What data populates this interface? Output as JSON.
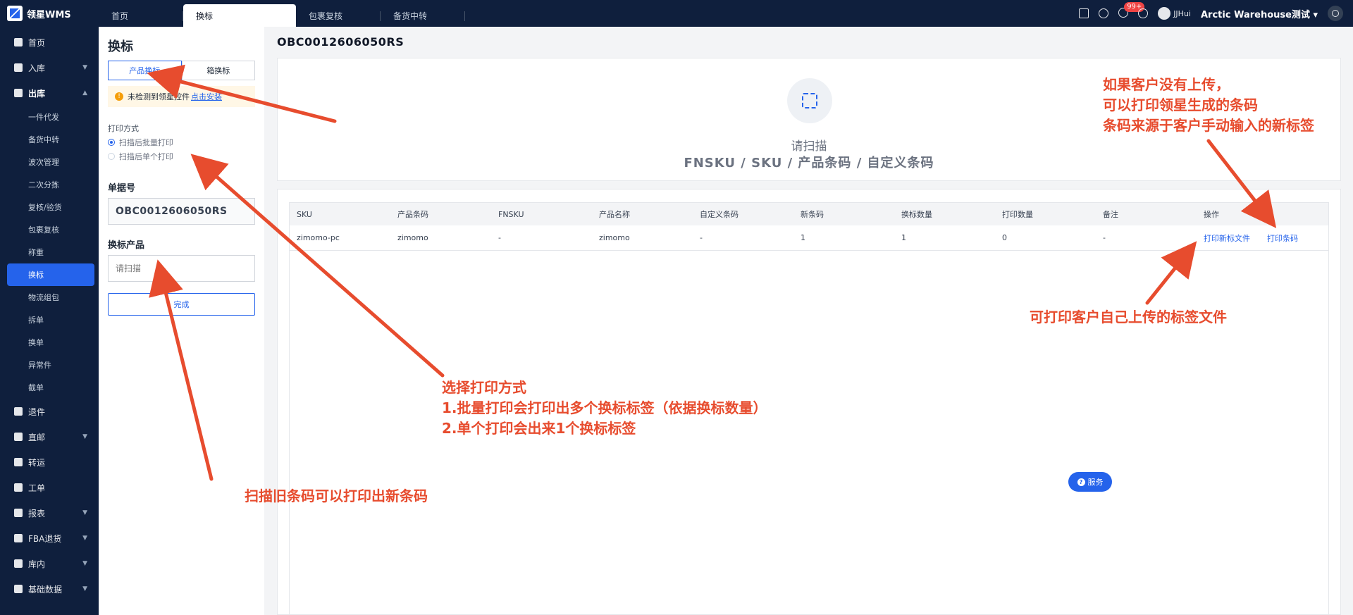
{
  "app": {
    "name": "领星WMS"
  },
  "tabs": [
    {
      "label": "首页"
    },
    {
      "label": "换标"
    },
    {
      "label": "包裹复核"
    },
    {
      "label": "备货中转"
    }
  ],
  "header": {
    "notification_count": "99+",
    "user": "JJHui",
    "warehouse": "Arctic Warehouse测试"
  },
  "sidebar": {
    "items": [
      {
        "label": "首页"
      },
      {
        "label": "入库"
      },
      {
        "label": "出库"
      },
      {
        "label": "退件"
      },
      {
        "label": "直邮"
      },
      {
        "label": "转运"
      },
      {
        "label": "工单"
      },
      {
        "label": "报表"
      },
      {
        "label": "FBA退货"
      },
      {
        "label": "库内"
      },
      {
        "label": "基础数据"
      }
    ],
    "outbound_sub": [
      {
        "label": "一件代发"
      },
      {
        "label": "备货中转"
      },
      {
        "label": "波次管理"
      },
      {
        "label": "二次分拣"
      },
      {
        "label": "复核/验货"
      },
      {
        "label": "包裹复核"
      },
      {
        "label": "称重"
      },
      {
        "label": "换标"
      },
      {
        "label": "物流组包"
      },
      {
        "label": "拆单"
      },
      {
        "label": "换单"
      },
      {
        "label": "异常件"
      },
      {
        "label": "截单"
      }
    ]
  },
  "left_panel": {
    "title": "换标",
    "segments": [
      "产品换标",
      "箱换标"
    ],
    "warning": "未检测到领星控件",
    "warning_link": "点击安装",
    "print_mode_label": "打印方式",
    "print_modes": [
      "扫描后批量打印",
      "扫描后单个打印"
    ],
    "doc_no_label": "单据号",
    "doc_no": "OBC0012606050RS",
    "product_label": "换标产品",
    "product_placeholder": "请扫描",
    "done_label": "完成"
  },
  "main": {
    "doc_id": "OBC0012606050RS",
    "scan_title": "请扫描",
    "scan_subtitle": "FNSKU / SKU / 产品条码 / 自定义条码"
  },
  "table": {
    "headers": [
      "SKU",
      "产品条码",
      "FNSKU",
      "产品名称",
      "自定义条码",
      "新条码",
      "换标数量",
      "打印数量",
      "备注",
      "操作"
    ],
    "rows": [
      [
        "zimomo-pc",
        "zimomo",
        "-",
        "zimomo",
        "-",
        "1",
        "1",
        "0",
        "-"
      ]
    ],
    "actions": [
      "打印新标文件",
      "打印条码"
    ]
  },
  "service_label": "服务",
  "annotations": {
    "top_right": [
      "如果客户没有上传，",
      "可以打印领星生成的条码",
      "条码来源于客户手动输入的新标签"
    ],
    "middle_right": "可打印客户自己上传的标签文件",
    "center": [
      "选择打印方式",
      "1.批量打印会打印出多个换标标签（依据换标数量）",
      "2.单个打印会出来1个换标标签"
    ],
    "bottom_left": "扫描旧条码可以打印出新条码",
    "color": "#e74c2e"
  },
  "colors": {
    "nav": "#0f1f3d",
    "accent": "#2563eb",
    "annotation": "#e74c2e"
  }
}
